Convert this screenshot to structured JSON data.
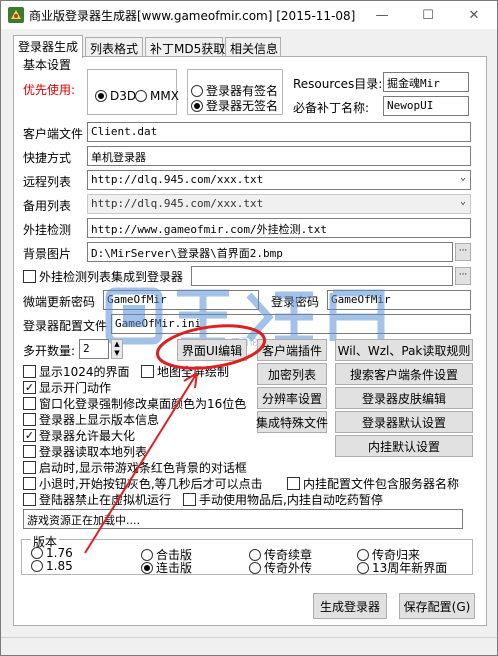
{
  "window": {
    "title": "商业版登录器生成器[www.gameofmir.com] [2015-11-08]",
    "minimize_glyph": "—",
    "maximize_glyph": "☐",
    "close_glyph": "✕"
  },
  "tabs": [
    {
      "label": "登录器生成",
      "active": true
    },
    {
      "label": "列表格式",
      "active": false
    },
    {
      "label": "补丁MD5获取",
      "active": false
    },
    {
      "label": "相关信息",
      "active": false
    }
  ],
  "basic": {
    "section_label": "基本设置",
    "priority_label": "优先使用:",
    "render_options": [
      {
        "label": "D3D",
        "selected": true
      },
      {
        "label": "MMX",
        "selected": false
      }
    ],
    "signature_options": [
      {
        "label": "登录器有签名",
        "selected": false
      },
      {
        "label": "登录器无签名",
        "selected": true
      }
    ],
    "resources_label": "Resources目录:",
    "resources_value": "掘金魂Mir",
    "patch_label": "必备补丁名称:",
    "patch_value": "NewopUI"
  },
  "fields": {
    "client_file_label": "客户端文件",
    "client_file_value": "Client.dat",
    "shortcut_label": "快捷方式",
    "shortcut_value": "单机登录器",
    "remote_list_label": "远程列表",
    "remote_list_value": "http://dlq.945.com/xxx.txt",
    "backup_list_label": "备用列表",
    "backup_list_value": "http://dlq.945.com/xxx.txt",
    "cheat_check_label": "外挂检测",
    "cheat_check_value": "http://www.gameofmir.com/外挂检测.txt",
    "bg_image_label": "背景图片",
    "bg_image_value": "D:\\MirServer\\登录器\\首界面2.bmp",
    "cheat_list_integrate_label": "外挂检测列表集成到登录器",
    "cheat_list_integrate_checked": false,
    "cheat_list_integrate_value": "",
    "micro_update_pwd_label": "微端更新密码",
    "micro_update_pwd_value": "GameOfMir",
    "login_pwd_label": "登录密码",
    "login_pwd_value": "GameOfMir",
    "config_file_label": "登录器配置文件",
    "config_file_value": "GameOfMir.ini",
    "multi_open_label": "多开数量:",
    "multi_open_value": "2",
    "browse_glyph": "···"
  },
  "action_buttons": {
    "ui_editor": "界面UI编辑",
    "client_plugin": "客户端插件",
    "wil_rules": "Wil、Wzl、Pak读取规则",
    "encrypt_list": "加密列表",
    "client_conditions": "搜索客户端条件设置",
    "resolution": "分辨率设置",
    "skin_editor": "登录器皮肤编辑",
    "integrate_file": "集成特殊文件",
    "default_settings": "登录器默认设置",
    "plugin_defaults": "内挂默认设置"
  },
  "options": [
    {
      "label": "显示1024的界面",
      "checked": false
    },
    {
      "label": "地图全屏绘制",
      "checked": false
    },
    {
      "label": "显示开门动作",
      "checked": true
    },
    {
      "label": "窗口化登录强制修改桌面颜色为16位色",
      "checked": false
    },
    {
      "label": "登录器上显示版本信息",
      "checked": false
    },
    {
      "label": "登录器允许最大化",
      "checked": true
    },
    {
      "label": "登录器读取本地列表",
      "checked": false
    },
    {
      "label": "启动时,显示带游戏条红色背景的对话框",
      "checked": false
    },
    {
      "label": "小退时,开始按钮灰色,等几秒后才可以点击",
      "checked": false
    },
    {
      "label": "内挂配置文件包含服务器名称",
      "checked": false
    },
    {
      "label": "登陆器禁止在虚拟机运行",
      "checked": false
    },
    {
      "label": "手动使用物品后,内挂自动吃药暂停",
      "checked": false
    }
  ],
  "status_text": "游戏资源正在加载中....",
  "version": {
    "section_label": "版本",
    "options": [
      {
        "label": "1.76",
        "selected": false
      },
      {
        "label": "1.85",
        "selected": false
      },
      {
        "label": "合击版",
        "selected": false
      },
      {
        "label": "连击版",
        "selected": true
      },
      {
        "label": "传奇续章",
        "selected": false
      },
      {
        "label": "传奇外传",
        "selected": false
      },
      {
        "label": "传奇归来",
        "selected": false
      },
      {
        "label": "13周年新界面",
        "selected": false
      }
    ]
  },
  "footer": {
    "generate_label": "生成登录器",
    "save_label": "保存配置(G)"
  },
  "watermark_text": "四百论坛",
  "colors": {
    "priority_red": "#e00000",
    "annotation_red": "#e02020",
    "watermark_blue": "#5b8fd6"
  }
}
